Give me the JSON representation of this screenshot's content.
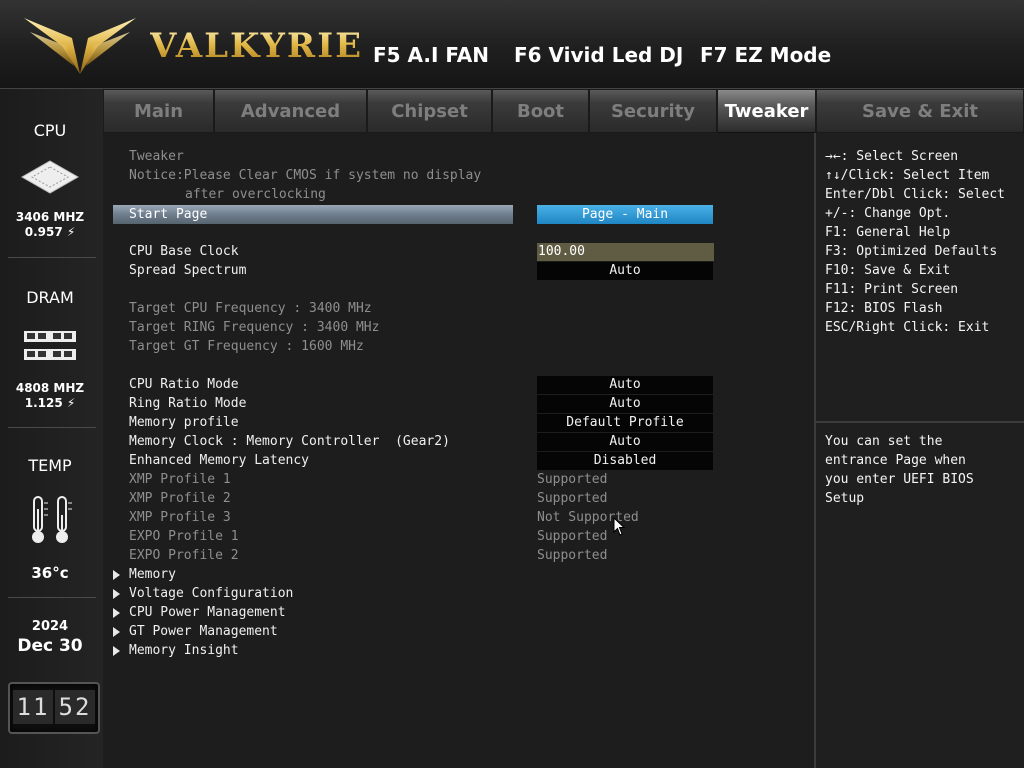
{
  "header": {
    "brand": "VALKYRIE",
    "hotkeys": [
      "F5 A.I FAN",
      "F6 Vivid Led DJ",
      "F7 EZ Mode"
    ]
  },
  "sidebar": {
    "cpu": {
      "label": "CPU",
      "freq": "3406 MHZ",
      "volt": "0.957 ⚡"
    },
    "dram": {
      "label": "DRAM",
      "freq": "4808 MHZ",
      "volt": "1.125 ⚡"
    },
    "temp": {
      "label": "TEMP",
      "value": "36°c"
    },
    "date": {
      "year": "2024",
      "day": "Dec 30"
    },
    "clock": {
      "hours": "11",
      "minutes": "52"
    }
  },
  "tabs": [
    "Main",
    "Advanced",
    "Chipset",
    "Boot",
    "Security",
    "Tweaker",
    "Save & Exit"
  ],
  "active_tab": "Tweaker",
  "main": {
    "section_title": "Tweaker",
    "notice_line1": "Notice:Please Clear CMOS if system no display",
    "notice_line2": "after overclocking",
    "start_page": {
      "label": "Start Page",
      "value": "Page - Main"
    },
    "cpu_base_clock": {
      "label": "CPU Base Clock",
      "value": "100.00"
    },
    "spread_spectrum": {
      "label": "Spread Spectrum",
      "value": "Auto"
    },
    "targets": [
      "Target CPU Frequency : 3400 MHz",
      "Target RING Frequency : 3400 MHz",
      "Target GT Frequency : 1600 MHz"
    ],
    "options": [
      {
        "label": "CPU Ratio Mode",
        "value": "Auto"
      },
      {
        "label": "Ring Ratio Mode",
        "value": "Auto"
      },
      {
        "label": "Memory profile",
        "value": "Default Profile"
      },
      {
        "label": "Memory Clock : Memory Controller  (Gear2)",
        "value": "Auto"
      },
      {
        "label": "Enhanced Memory Latency",
        "value": "Disabled"
      }
    ],
    "profiles": [
      {
        "label": "XMP Profile 1",
        "value": "Supported"
      },
      {
        "label": "XMP Profile 2",
        "value": "Supported"
      },
      {
        "label": "XMP Profile 3",
        "value": "Not Supported"
      },
      {
        "label": "EXPO Profile 1",
        "value": "Supported"
      },
      {
        "label": "EXPO Profile 2",
        "value": "Supported"
      }
    ],
    "submenus": [
      "Memory",
      "Voltage Configuration",
      "CPU Power Management",
      "GT Power Management",
      "Memory Insight"
    ]
  },
  "help": {
    "keys": [
      "→←: Select Screen",
      "↑↓/Click: Select Item",
      "Enter/Dbl Click: Select",
      "+/-: Change Opt.",
      "F1: General Help",
      "F3: Optimized Defaults",
      "F10: Save & Exit",
      "F11: Print Screen",
      "F12: BIOS Flash",
      "ESC/Right Click: Exit"
    ],
    "description": [
      "You can set the",
      "entrance Page when",
      "you enter UEFI BIOS",
      "Setup"
    ]
  },
  "colors": {
    "gold": "#e2b948",
    "selected_value": "#1f86c4",
    "option_bg": "#050505",
    "input_bg": "#605c44"
  }
}
